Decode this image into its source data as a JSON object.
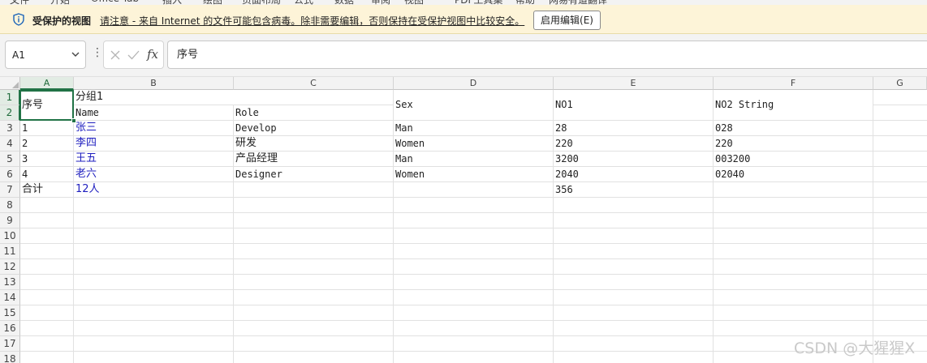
{
  "ribbon": {
    "tabs": [
      "文件",
      "开始",
      "Office Tab",
      "插入",
      "绘图",
      "页面布局",
      "公式",
      "数据",
      "审阅",
      "视图",
      "PDF工具集",
      "帮助",
      "网易有道翻译"
    ]
  },
  "protected_view": {
    "title": "受保护的视图",
    "message": "请注意 - 来自 Internet 的文件可能包含病毒。除非需要编辑，否则保持在受保护视图中比较安全。",
    "enable_button": "启用编辑(E)",
    "icon": "shield-info-icon"
  },
  "formula_bar": {
    "name_box": "A1",
    "fx_label": "fx",
    "content": "序号"
  },
  "columns": [
    "A",
    "B",
    "C",
    "D",
    "E",
    "F",
    "G"
  ],
  "selected_column": "A",
  "rows": [
    "1",
    "2",
    "3",
    "4",
    "5",
    "6",
    "7",
    "8",
    "9",
    "10",
    "11",
    "12",
    "13",
    "14",
    "15",
    "16",
    "17",
    "18"
  ],
  "selected_rows": [
    "1",
    "2"
  ],
  "sheet": {
    "a1_merged": "序号",
    "b1_group": "分组1",
    "b2": "Name",
    "c2": "Role",
    "d_merged": "Sex",
    "e_merged": "NO1",
    "f_merged": "NO2 String",
    "data_rows": [
      {
        "a": "1",
        "b": "张三",
        "c": "Develop",
        "d": "Man",
        "e": "28",
        "f": "028"
      },
      {
        "a": "2",
        "b": "李四",
        "c": "研发",
        "d": "Women",
        "e": "220",
        "f": "220"
      },
      {
        "a": "3",
        "b": "王五",
        "c": "产品经理",
        "d": "Man",
        "e": "3200",
        "f": "003200"
      },
      {
        "a": "4",
        "b": "老六",
        "c": "Designer",
        "d": "Women",
        "e": "2040",
        "f": "02040"
      }
    ],
    "total_row": {
      "a": "合计",
      "b": "12人",
      "e": "356"
    }
  },
  "colors": {
    "accent_green": "#217346",
    "name_text_blue": "#1f1fbf",
    "protected_bar_bg": "#fdf4d8"
  },
  "watermark": "CSDN @大猩猩X"
}
